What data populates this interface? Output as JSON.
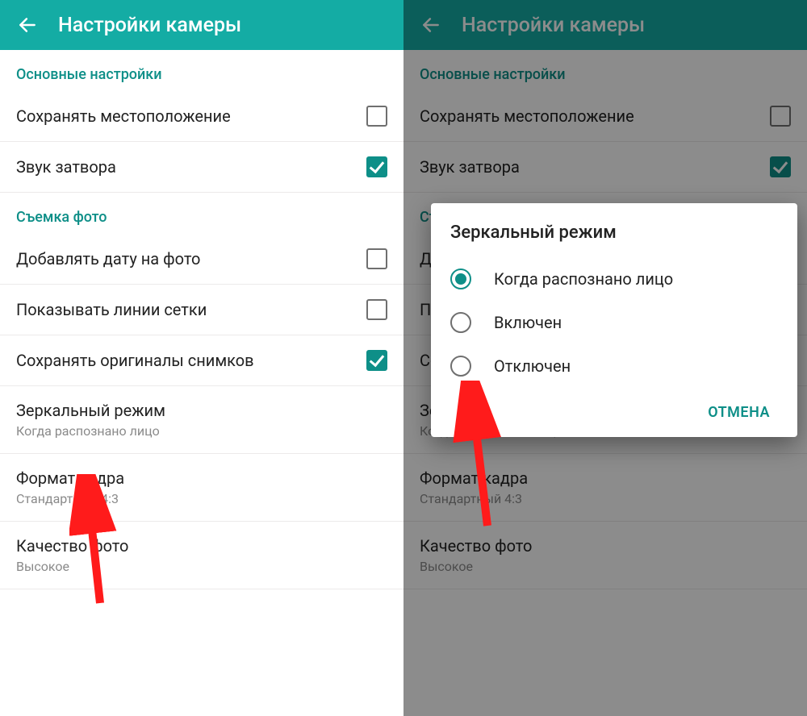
{
  "appbar": {
    "title": "Настройки камеры"
  },
  "sections": {
    "main_header": "Основные настройки",
    "photo_header": "Съемка фото"
  },
  "settings": {
    "save_location": {
      "label": "Сохранять местоположение",
      "checked": false
    },
    "shutter_sound": {
      "label": "Звук затвора",
      "checked": true
    },
    "add_date": {
      "label": "Добавлять дату на фото",
      "checked": false
    },
    "show_grid": {
      "label": "Показывать линии сетки",
      "checked": false
    },
    "save_originals": {
      "label": "Сохранять оригиналы снимков",
      "checked": true
    },
    "mirror_mode": {
      "label": "Зеркальный режим",
      "value": "Когда распознано лицо"
    },
    "frame_format": {
      "label": "Формат кадра",
      "value": "Стандартный 4:3"
    },
    "photo_quality": {
      "label": "Качество фото",
      "value": "Высокое"
    }
  },
  "dialog": {
    "title": "Зеркальный режим",
    "options": [
      {
        "label": "Когда распознано лицо",
        "selected": true
      },
      {
        "label": "Включен",
        "selected": false
      },
      {
        "label": "Отключен",
        "selected": false
      }
    ],
    "cancel": "ОТМЕНА"
  }
}
